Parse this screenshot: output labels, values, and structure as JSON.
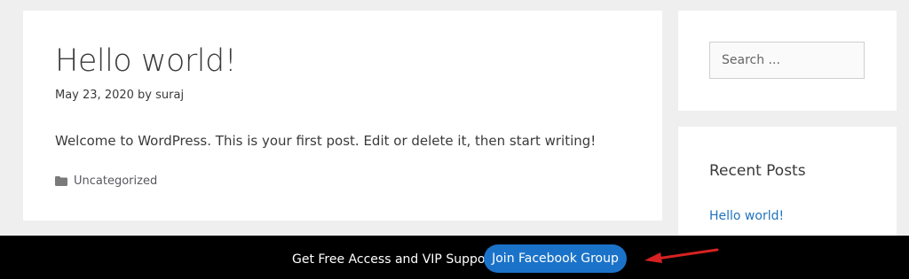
{
  "post": {
    "title": "Hello world!",
    "date": "May 23, 2020",
    "by": "by",
    "author": "suraj",
    "excerpt": "Welcome to WordPress. This is your first post. Edit or delete it, then start writing!",
    "category": "Uncategorized",
    "category_icon": "folder-icon"
  },
  "sidebar": {
    "search": {
      "placeholder": "Search ..."
    },
    "recent_posts": {
      "title": "Recent Posts",
      "items": [
        {
          "label": "Hello world!"
        }
      ]
    }
  },
  "promo_bar": {
    "text": "Get Free Access and VIP Support",
    "button_label": "Join Facebook Group",
    "annotation_icon": "red-arrow-icon"
  },
  "colors": {
    "page_background": "#efefef",
    "link": "#1e73be",
    "promo_background": "#000000",
    "promo_button": "#1b73c9",
    "annotation_arrow": "#d62222"
  }
}
